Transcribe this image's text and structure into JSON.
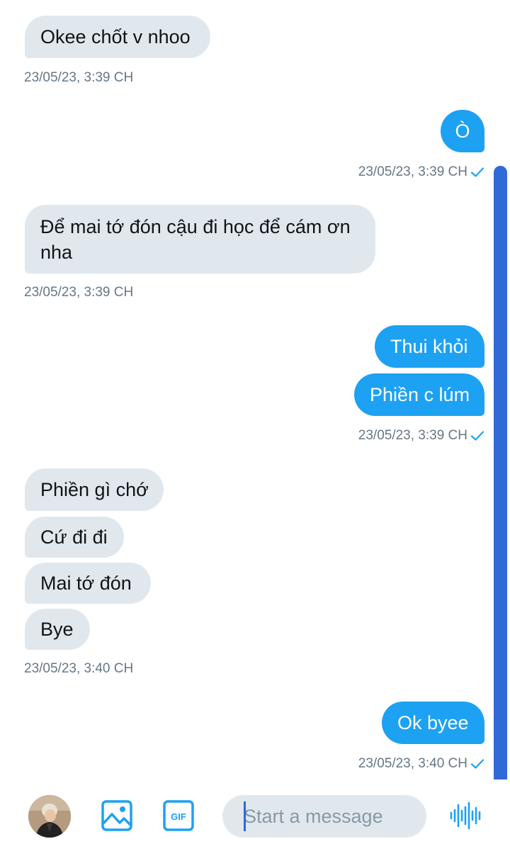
{
  "conversation": {
    "messages": [
      {
        "text": "Okee chốt v nhoo"
      },
      {
        "text": "Ò"
      },
      {
        "text": "Để mai tớ đón cậu đi học để cám ơn nha"
      },
      {
        "text": "Thui khỏi"
      },
      {
        "text": "Phiền c lúm"
      },
      {
        "text": "Phiền gì chớ"
      },
      {
        "text": "Cứ đi đi"
      },
      {
        "text": "Mai tớ đón"
      },
      {
        "text": "Bye"
      },
      {
        "text": "Ok byee"
      }
    ],
    "timestamps": [
      "23/05/23, 3:39 CH",
      "23/05/23, 3:39 CH",
      "23/05/23, 3:39 CH",
      "23/05/23, 3:39 CH",
      "23/05/23, 3:40 CH",
      "23/05/23, 3:40 CH"
    ]
  },
  "composer": {
    "placeholder": "Start a message",
    "value": "",
    "icons": {
      "avatar": "user-avatar",
      "media": "image-icon",
      "gif": "gif-icon",
      "voice": "voice-waveform-icon"
    }
  },
  "colors": {
    "incoming_bubble": "#e1e8ed",
    "outgoing_bubble": "#1da1f2",
    "timestamp": "#657786",
    "check": "#1da1f2",
    "scrollbar": "#2f6ad6"
  }
}
